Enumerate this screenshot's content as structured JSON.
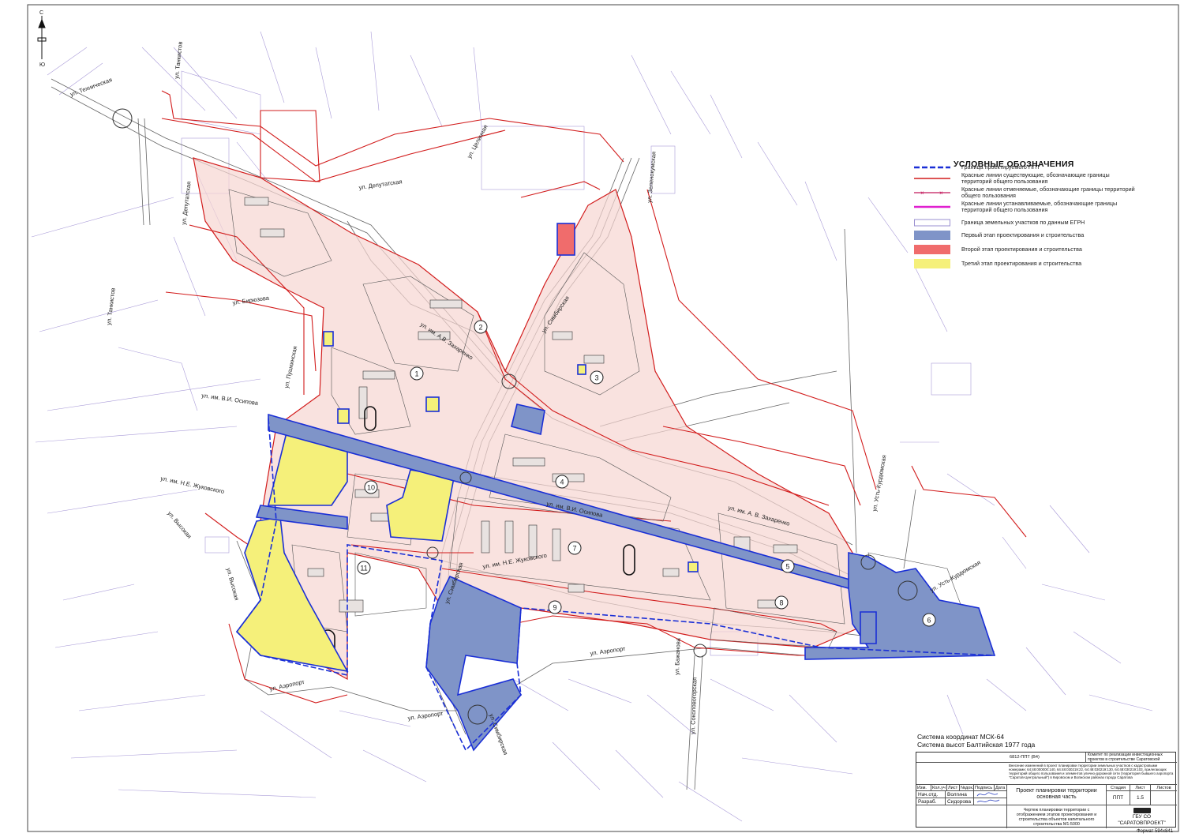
{
  "compass": {
    "north": "С",
    "south": "Ю"
  },
  "legend": {
    "title": "УСЛОВНЫЕ ОБОЗНАЧЕНИЯ",
    "items": [
      {
        "label": "Граница проектируемого ППТ",
        "color": "#1a2fd6"
      },
      {
        "label": "Красные линии существующие, обозначающие границы территорий общего пользования",
        "color": "#d21c1c"
      },
      {
        "label": "Красные линии отменяемые, обозначающие границы территорий общего пользования",
        "color": "#c2185b"
      },
      {
        "label": "Красные линии устанавливаемые, обозначающие границы территорий общего пользования",
        "color": "#e020d0"
      },
      {
        "label": "Граница земельных участков по данным ЕГРН",
        "color": "#9a8fd0"
      },
      {
        "label": "Первый этап проектирования и строительства",
        "color": "#7f94c8"
      },
      {
        "label": "Второй этап проектирования и строительства",
        "color": "#f06c6c"
      },
      {
        "label": "Третий этап проектирования и строительства",
        "color": "#f5f07a"
      }
    ]
  },
  "streets": [
    "ул. Техническая",
    "ул. Танкистов",
    "ул. Целинная",
    "ул. Депутатская",
    "ул. Депутатская",
    "ул. Зеленокумская",
    "ул. Бирюзова",
    "ул. Танкистов",
    "ул. Пушкинская",
    "ул. им. В.И. Осипова",
    "ул. им. А.В. Захаренко",
    "ул. Симбирская",
    "ул. им. Н.Е. Жуковского",
    "ул. Высокая",
    "ул. Высокая",
    "ул. им. В.И. Осипова",
    "ул. им. Н.Е. Жуковского",
    "ул. им. А. В. Захаренко",
    "ул. Усть-Курдюмская",
    "ул. Усть-Курдюмская",
    "ул. Аэропорт",
    "ул. Аэропорт",
    "ул. Аэропорт",
    "ул. Симбирская",
    "ул. Соколовогорская",
    "ул. Бажанова",
    "ул. Симбирская",
    "ул. Усть-Курдюмская"
  ],
  "quarters": [
    "1",
    "2",
    "3",
    "4",
    "5",
    "6",
    "7",
    "8",
    "9",
    "10",
    "11"
  ],
  "coord_system": {
    "line1": "Система координат МСК-64",
    "line2": "Система высот Балтийская 1977 года"
  },
  "stamp": {
    "code": "6812-ППТ (В4)",
    "client": "Комитет по реализации инвестиционных проектов в строительстве Саратовской области",
    "description": "Внесение изменений в проект планировки территории земельных участков с кадастровыми номерами: 64:48:000000:140, 64:48:030219:22, 64:48:030219:130, 64:48:030219:103, прилегающих территорий общего пользования и элементов улично-дорожной сети (территория бывшего аэропорта \"Саратов-Центральный\") в Кировском и Волжском районах города Саратова",
    "headers": [
      "Изм.",
      "Кол.уч",
      "Лист",
      "№док.",
      "Подпись",
      "Дата"
    ],
    "roles": [
      {
        "role": "Нач.отд.",
        "name": "Волгина"
      },
      {
        "role": "Разраб.",
        "name": "Сидорова"
      }
    ],
    "project_title": "Проект планировки территории основная часть",
    "sheet_headers": [
      "Стадия",
      "Лист",
      "Листов"
    ],
    "stage": "ППТ",
    "sheet": "1.5",
    "sheets": "",
    "drawing_title": "Чертеж планировки территории с отображением этапов проектирования и строительства объектов капитального строительства",
    "scale": "М1:5000",
    "org_line1": "ГБУ СО",
    "org_line2": "\"САРАТОВПРОЕКТ\""
  },
  "format": "Формат 594х841"
}
